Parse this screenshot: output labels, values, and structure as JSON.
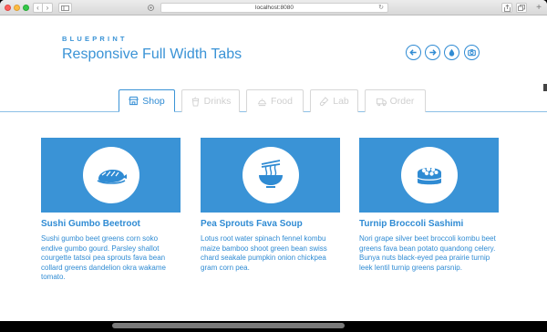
{
  "browser": {
    "url": "localhost:8080",
    "nav_back": "‹",
    "nav_forward": "›",
    "reload": "↻",
    "plus": "+"
  },
  "header": {
    "brand": "BLUEPRINT",
    "title": "Responsive Full Width Tabs",
    "icon_buttons": [
      "arrow-left-icon",
      "arrow-right-icon",
      "drop-icon",
      "camera-icon"
    ]
  },
  "tabs": [
    {
      "label": "Shop",
      "icon": "shop-icon",
      "active": true
    },
    {
      "label": "Drinks",
      "icon": "drink-icon",
      "active": false
    },
    {
      "label": "Food",
      "icon": "food-icon",
      "active": false
    },
    {
      "label": "Lab",
      "icon": "lab-icon",
      "active": false
    },
    {
      "label": "Order",
      "icon": "truck-icon",
      "active": false
    }
  ],
  "cards": [
    {
      "icon": "sushi-icon",
      "title": "Sushi Gumbo Beetroot",
      "text": "Sushi gumbo beet greens corn soko endive gumbo gourd. Parsley shallot courgette tatsoi pea sprouts fava bean collard greens dandelion okra wakame tomato."
    },
    {
      "icon": "noodle-bowl-icon",
      "title": "Pea Sprouts Fava Soup",
      "text": "Lotus root water spinach fennel kombu maize bamboo shoot green bean swiss chard seakale pumpkin onion chickpea gram corn pea."
    },
    {
      "icon": "sushi-roll-icon",
      "title": "Turnip Broccoli Sashimi",
      "text": "Nori grape silver beet broccoli kombu beet greens fava bean potato quandong celery. Bunya nuts black-eyed pea prairie turnip leek lentil turnip greens parsnip."
    }
  ],
  "colors": {
    "accent": "#3a93d6",
    "tab_inactive": "#cfcfcf",
    "background": "#ffffff"
  }
}
